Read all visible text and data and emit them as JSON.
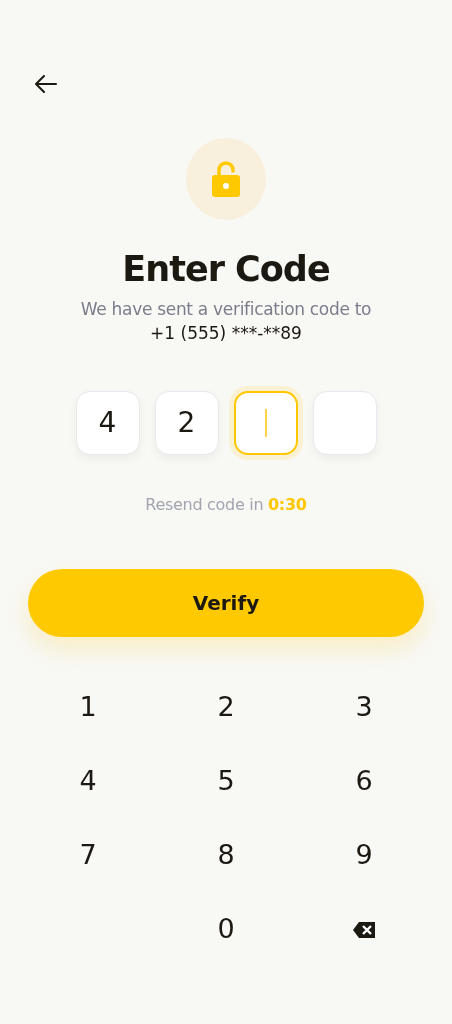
{
  "title": "Enter Code",
  "subtitle": "We have sent a verification code to",
  "phone": "+1 (555) ***-**89",
  "code_boxes": [
    {
      "value": "4",
      "selected": false
    },
    {
      "value": "2",
      "selected": false
    },
    {
      "selected": true
    },
    {
      "selected": false
    }
  ],
  "resend": {
    "label": "Resend code in",
    "timer": "0:30"
  },
  "verify_button": "Verify",
  "keypad": [
    {
      "kind": "digit",
      "label": "1"
    },
    {
      "kind": "digit",
      "label": "2"
    },
    {
      "kind": "digit",
      "label": "3"
    },
    {
      "kind": "digit",
      "label": "4"
    },
    {
      "kind": "digit",
      "label": "5"
    },
    {
      "kind": "digit",
      "label": "6"
    },
    {
      "kind": "digit",
      "label": "7"
    },
    {
      "kind": "digit",
      "label": "8"
    },
    {
      "kind": "digit",
      "label": "9"
    },
    {
      "kind": "blank"
    },
    {
      "kind": "digit",
      "label": "0"
    },
    {
      "kind": "backspace"
    }
  ]
}
